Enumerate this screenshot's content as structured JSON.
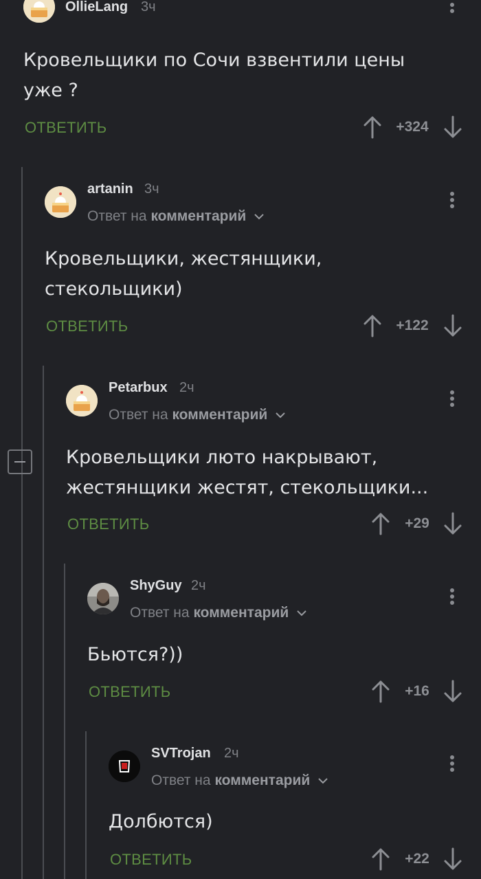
{
  "comments": [
    {
      "user": "OllieLang",
      "time": "3ч",
      "text_lines": [
        "Кровельщики по Сочи взвентили цены",
        "уже ?"
      ],
      "reply_label": "ОТВЕТИТЬ",
      "score": "+324",
      "avatar": "cake-avatar"
    },
    {
      "user": "artanin",
      "time": "3ч",
      "reply_prefix": "Ответ на",
      "reply_target": "комментарий",
      "text_lines": [
        "Кровельщики, жестянщики,",
        "стекольщики)"
      ],
      "reply_label": "ОТВЕТИТЬ",
      "score": "+122",
      "avatar": "cake-avatar"
    },
    {
      "user": "Petarbux",
      "time": "2ч",
      "reply_prefix": "Ответ на",
      "reply_target": "комментарий",
      "text_lines": [
        "Кровельщики люто накрывают,",
        "жестянщики жестят, стекольщики..."
      ],
      "reply_label": "ОТВЕТИТЬ",
      "score": "+29",
      "avatar": "cake-avatar"
    },
    {
      "user": "ShyGuy",
      "time": "2ч",
      "reply_prefix": "Ответ на",
      "reply_target": "комментарий",
      "text_lines": [
        "Бьются?))"
      ],
      "reply_label": "ОТВЕТИТЬ",
      "score": "+16",
      "avatar": "photo-avatar"
    },
    {
      "user": "SVTrojan",
      "time": "2ч",
      "reply_prefix": "Ответ на",
      "reply_target": "комментарий",
      "text_lines": [
        "Долбются)"
      ],
      "reply_label": "ОТВЕТИТЬ",
      "score": "+22",
      "avatar": "logo-avatar"
    }
  ],
  "icons": {
    "upvote": "arrow-up-icon",
    "downvote": "arrow-down-icon",
    "more": "more-vertical-icon",
    "collapse": "collapse-thread-icon",
    "chevron": "chevron-down-icon"
  },
  "colors": {
    "background": "#212226",
    "reply": "#5e8d43",
    "text": "#e4e5e7",
    "muted": "#7f8186"
  }
}
